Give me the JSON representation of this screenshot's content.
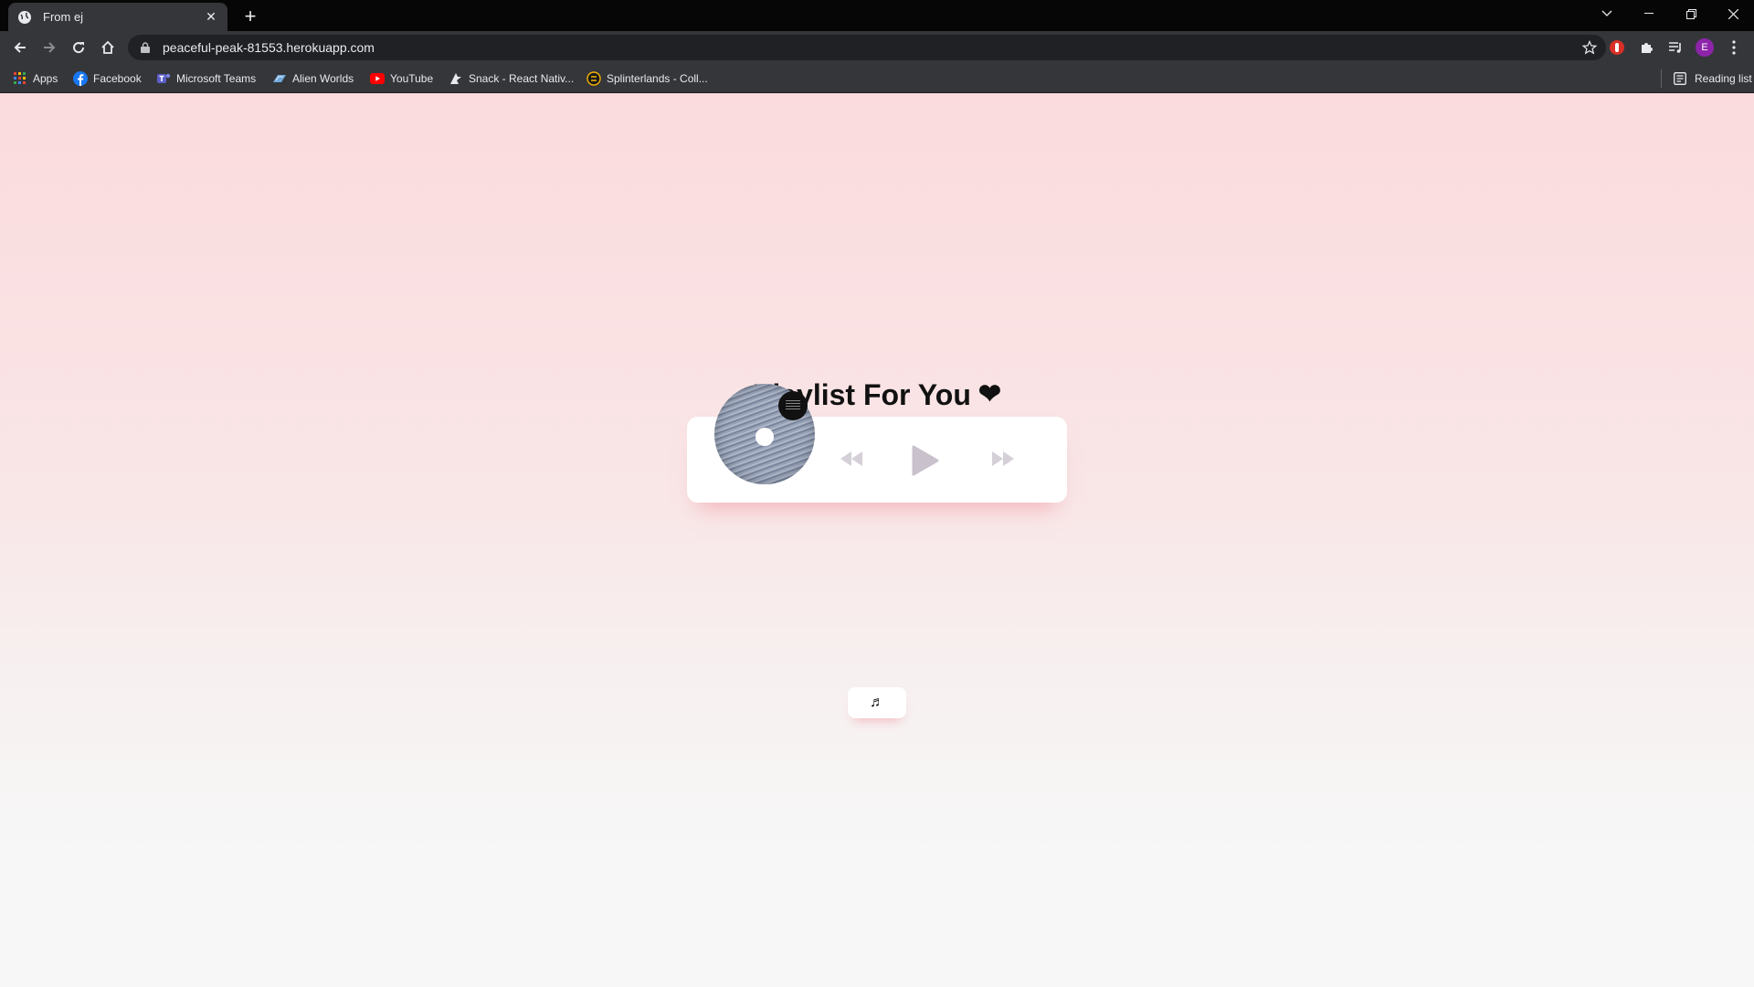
{
  "browser": {
    "tab": {
      "title": "From ej",
      "favicon": "globe-icon"
    },
    "address": {
      "url": "peaceful-peak-81553.herokuapp.com"
    },
    "profile_initial": "E",
    "bookmarks": [
      {
        "label": "Apps",
        "icon": "apps-grid-icon"
      },
      {
        "label": "Facebook",
        "icon": "facebook-icon"
      },
      {
        "label": "Microsoft Teams",
        "icon": "teams-icon"
      },
      {
        "label": "Alien Worlds",
        "icon": "alien-worlds-icon"
      },
      {
        "label": "YouTube",
        "icon": "youtube-icon"
      },
      {
        "label": "Snack - React Nativ...",
        "icon": "snack-icon"
      },
      {
        "label": "Splinterlands - Coll...",
        "icon": "splinterlands-icon"
      }
    ],
    "reading_list": "Reading list"
  },
  "page": {
    "heading": "Playlist For You",
    "heading_emoji": "❤",
    "player": {
      "prev_icon": "rewind-icon",
      "play_icon": "play-icon",
      "next_icon": "fast-forward-icon",
      "control_color": "#c9c2cc"
    },
    "music_button_icon": "♬"
  },
  "colors": {
    "page_top": "#fbdbdd",
    "page_bottom": "#f7f7f7",
    "chrome_dark": "#35363a"
  }
}
